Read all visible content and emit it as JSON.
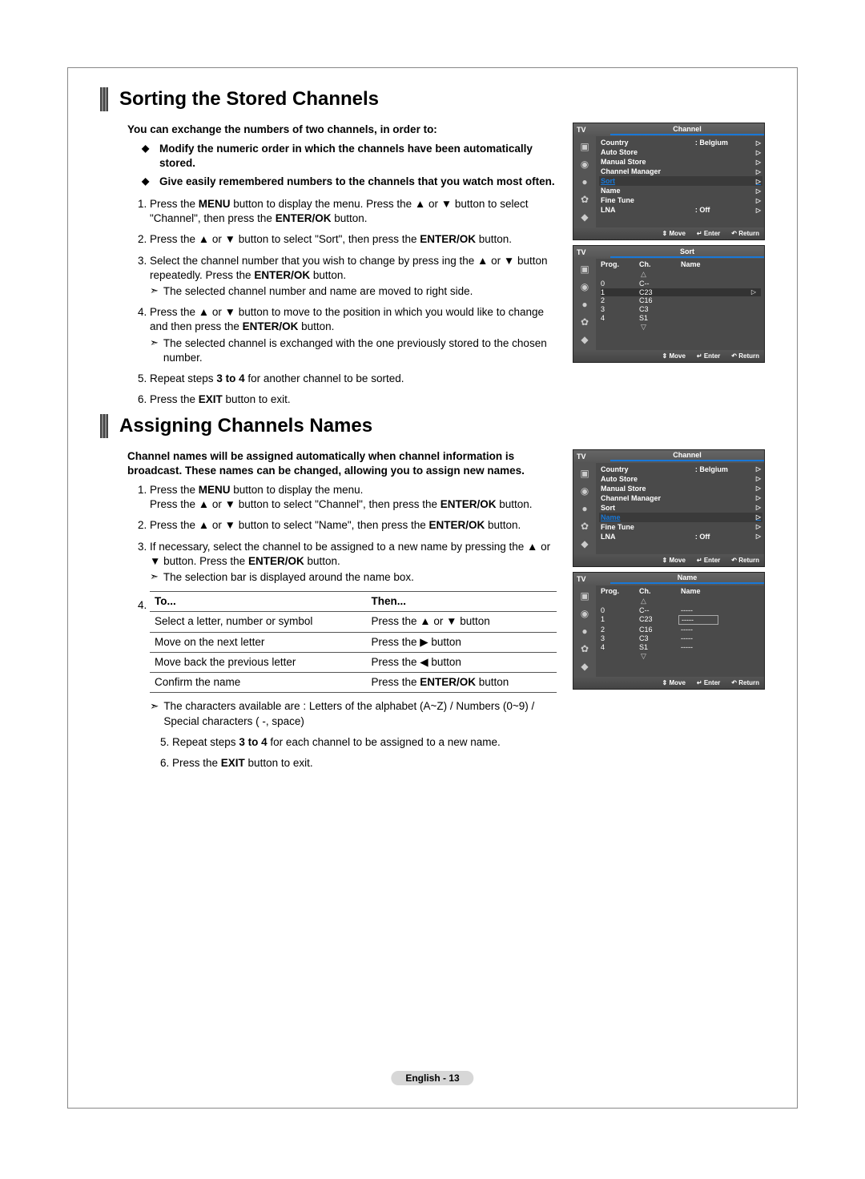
{
  "section1": {
    "heading": "Sorting the Stored Channels",
    "intro": "You can exchange the numbers of two channels, in order to:",
    "bullets": [
      "Modify the numeric order in which the channels have been automatically stored.",
      "Give easily remembered numbers to the channels that you watch most often."
    ],
    "steps": {
      "s1a": "Press the ",
      "s1b": "MENU",
      "s1c": " button to display the menu.  Press the ▲ or ▼ button to select \"Channel\", then press the ",
      "s1d": "ENTER/OK",
      "s1e": " button.",
      "s2a": "Press the ▲ or ▼ button to select \"Sort\", then press the ",
      "s2b": "ENTER/OK",
      "s2c": " button.",
      "s3a": "Select the channel number that you wish to change by press ing the ▲ or ▼ button repeatedly. Press the ",
      "s3b": "ENTER/OK",
      "s3c": " button.",
      "s3note": "The selected channel number and name are moved to right side.",
      "s4a": "Press the ▲ or ▼ button to move to the position in which you would like to change and then press the  ",
      "s4b": "ENTER/OK",
      "s4c": " button.",
      "s4note": "The selected channel is exchanged with the one previously stored to the chosen number.",
      "s5a": "Repeat steps ",
      "s5b": "3 to 4",
      "s5c": " for another channel to be sorted.",
      "s6a": "Press the ",
      "s6b": "EXIT",
      "s6c": " button to exit."
    },
    "osd1": {
      "title": "Channel",
      "items": [
        {
          "label": "Country",
          "value": ": Belgium",
          "chev": true
        },
        {
          "label": "Auto Store",
          "value": "",
          "chev": true
        },
        {
          "label": "Manual Store",
          "value": "",
          "chev": true
        },
        {
          "label": "Channel Manager",
          "value": "",
          "chev": true
        },
        {
          "label": "Sort",
          "value": "",
          "chev": true,
          "hl": true
        },
        {
          "label": "Name",
          "value": "",
          "chev": true
        },
        {
          "label": "Fine Tune",
          "value": "",
          "chev": true
        },
        {
          "label": "LNA",
          "value": ": Off",
          "chev": true
        }
      ]
    },
    "osd2": {
      "title": "Sort",
      "cols": [
        "Prog.",
        "Ch.",
        "Name"
      ],
      "rows": [
        {
          "p": "0",
          "c": "C--",
          "n": ""
        },
        {
          "p": "1",
          "c": "C23",
          "n": "",
          "sel": true
        },
        {
          "p": "2",
          "c": "C16",
          "n": ""
        },
        {
          "p": "3",
          "c": "C3",
          "n": ""
        },
        {
          "p": "4",
          "c": "S1",
          "n": ""
        }
      ]
    },
    "footer": {
      "move": "Move",
      "enter": "Enter",
      "return": "Return"
    }
  },
  "section2": {
    "heading": "Assigning Channels Names",
    "intro": "Channel names will be assigned automatically when channel information is broadcast. These names can be changed, allowing you to assign new names.",
    "steps": {
      "s1a": "Press the ",
      "s1b": "MENU",
      "s1c": " button to display the menu.",
      "s1d": "Press the ▲ or ▼ button to select \"Channel\", then press the ",
      "s1e": "ENTER/OK",
      "s1f": " button.",
      "s2a": "Press the ▲ or ▼ button to select \"Name\", then press the ",
      "s2b": "ENTER/OK",
      "s2c": " button.",
      "s3a": "If necessary, select the channel to be assigned to a new name by pressing the ▲ or ▼ button. Press the ",
      "s3b": "ENTER/OK",
      "s3c": " button.",
      "s3note": "The selection bar is displayed around the name box.",
      "s5a": "Repeat steps ",
      "s5b": "3 to 4",
      "s5c": " for each channel to be assigned to a new name.",
      "s6a": "Press the ",
      "s6b": "EXIT",
      "s6c": " button to exit."
    },
    "table": {
      "num": "4.",
      "h1": "To...",
      "h2": "Then...",
      "r1a": "Select a letter, number or symbol",
      "r1b": "Press the ▲ or ▼ button",
      "r2a": "Move on the next letter",
      "r2b": "Press the ▶ button",
      "r3a": "Move back the previous letter",
      "r3b": "Press the ◀ button",
      "r4a": "Confirm the name",
      "r4b_a": "Press the ",
      "r4b_b": "ENTER/OK",
      "r4b_c": " button"
    },
    "after_note": "The characters available are : Letters of the alphabet (A~Z) / Numbers (0~9) / Special characters ( -, space)",
    "osd1": {
      "title": "Channel",
      "items": [
        {
          "label": "Country",
          "value": ": Belgium",
          "chev": true
        },
        {
          "label": "Auto Store",
          "value": "",
          "chev": true
        },
        {
          "label": "Manual Store",
          "value": "",
          "chev": true
        },
        {
          "label": "Channel Manager",
          "value": "",
          "chev": true
        },
        {
          "label": "Sort",
          "value": "",
          "chev": true
        },
        {
          "label": "Name",
          "value": "",
          "chev": true,
          "hl": true
        },
        {
          "label": "Fine Tune",
          "value": "",
          "chev": true
        },
        {
          "label": "LNA",
          "value": ": Off",
          "chev": true
        }
      ]
    },
    "osd2": {
      "title": "Name",
      "cols": [
        "Prog.",
        "Ch.",
        "Name"
      ],
      "rows": [
        {
          "p": "0",
          "c": "C--",
          "n": "-----"
        },
        {
          "p": "1",
          "c": "C23",
          "n": "-----",
          "sel2": true
        },
        {
          "p": "2",
          "c": "C16",
          "n": "-----"
        },
        {
          "p": "3",
          "c": "C3",
          "n": "-----"
        },
        {
          "p": "4",
          "c": "S1",
          "n": "-----"
        }
      ]
    },
    "footer": {
      "move": "Move",
      "enter": "Enter",
      "return": "Return"
    }
  },
  "tv_label": "TV",
  "page_footer": "English - 13"
}
